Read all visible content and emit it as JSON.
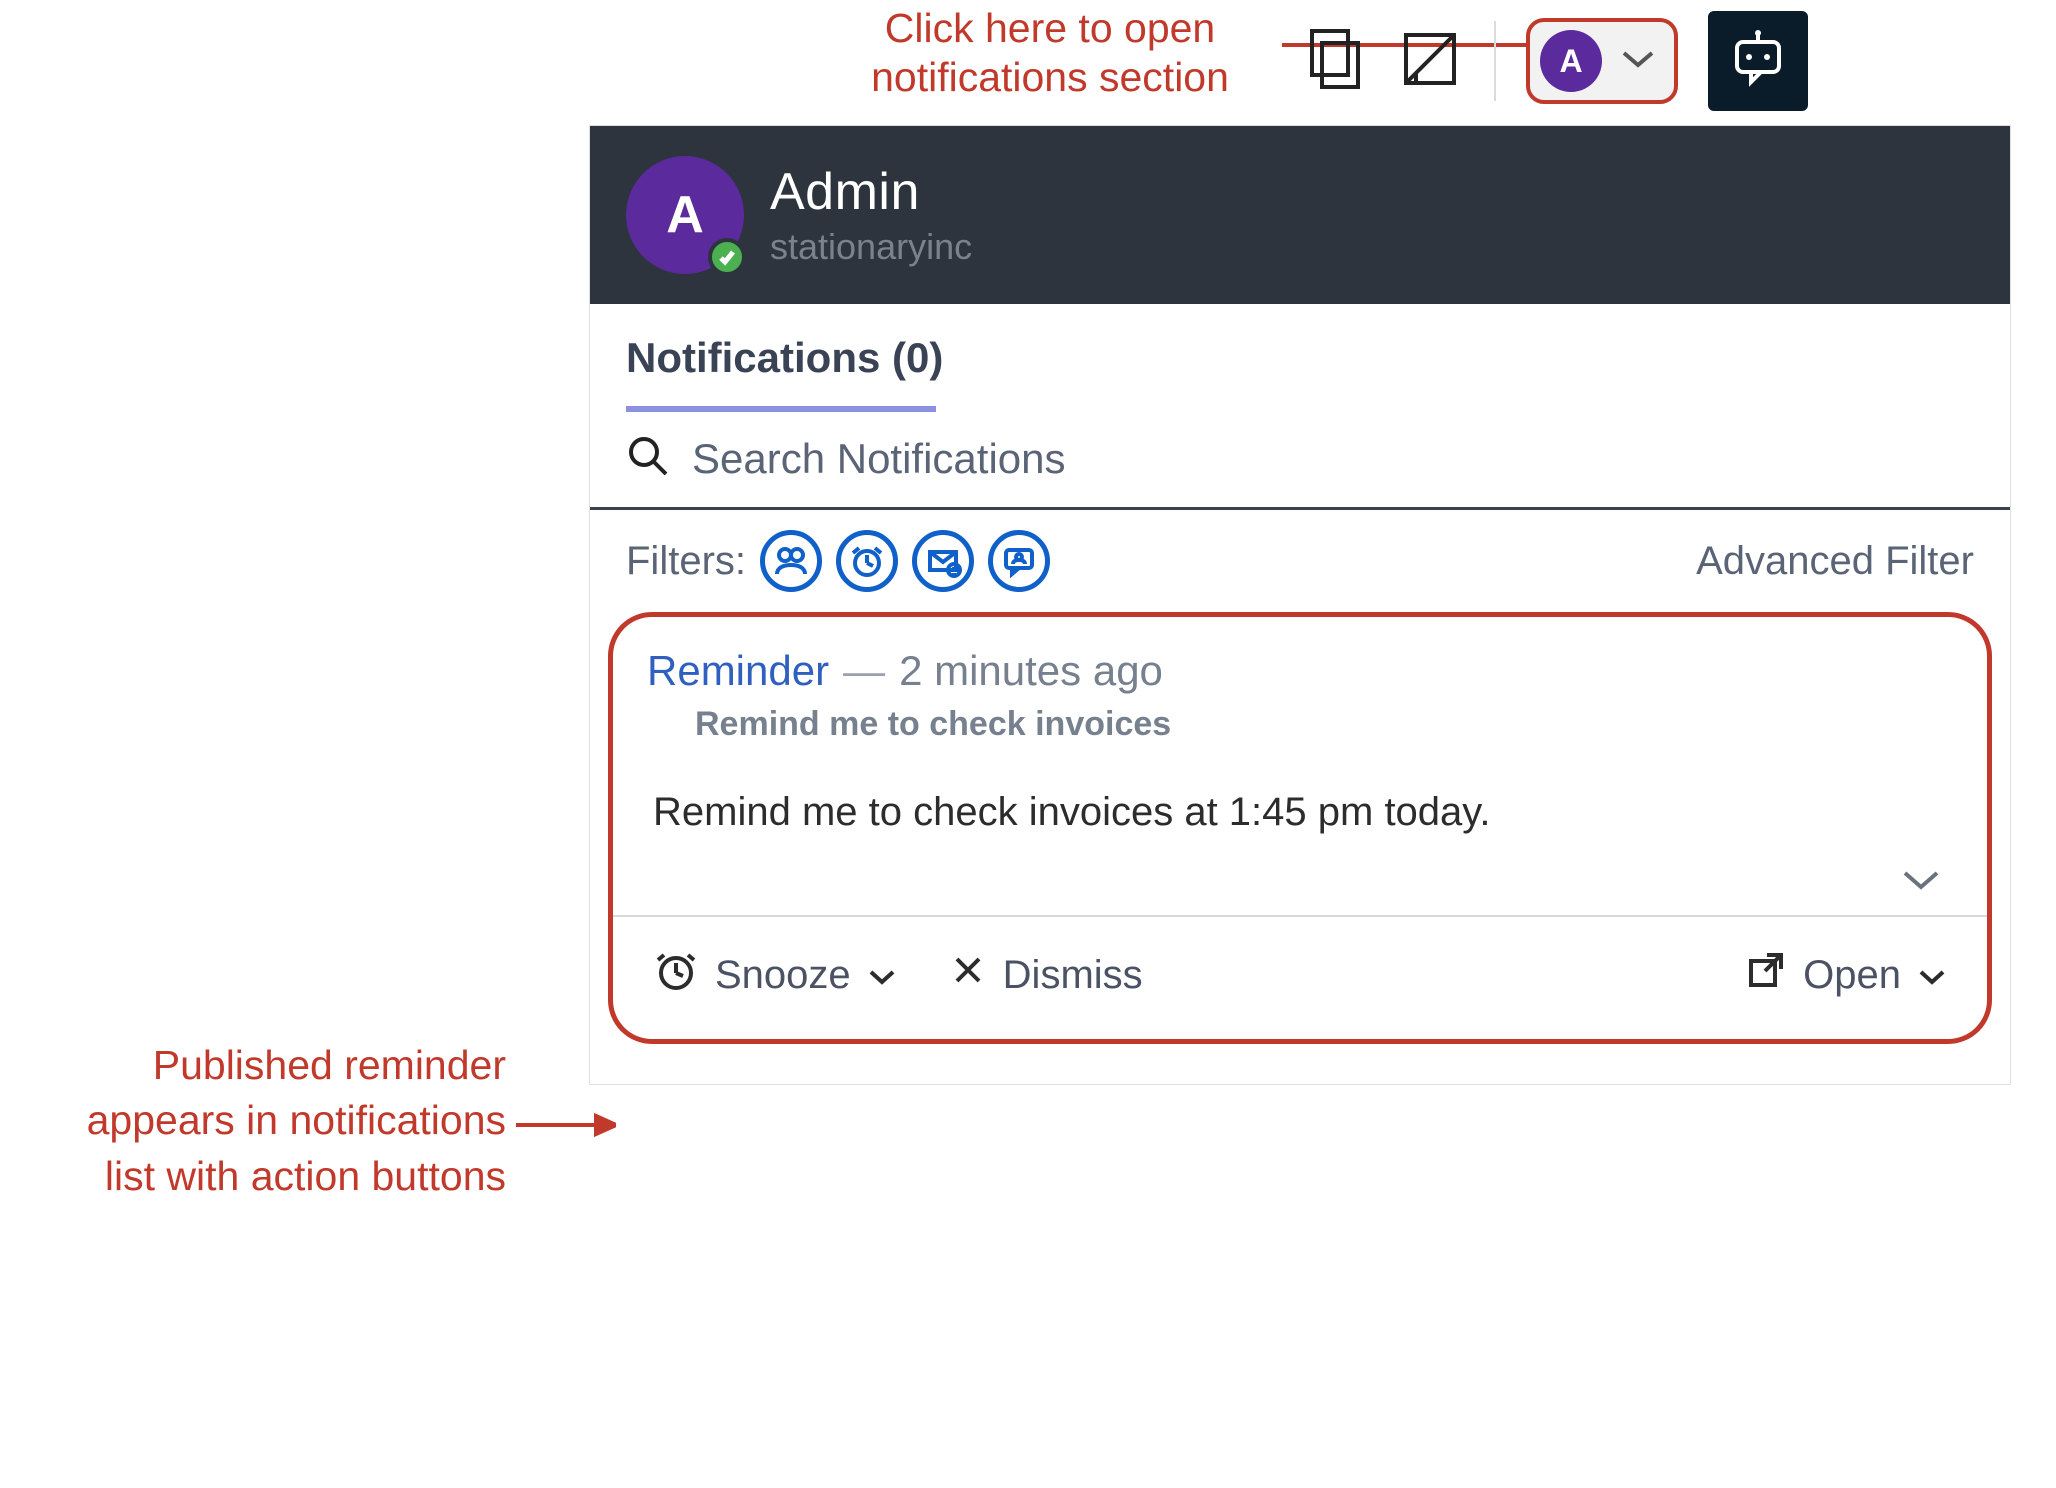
{
  "annotations": {
    "top": "Click here to open\nnotifications section",
    "left": "Published reminder appears in notifications list with action buttons"
  },
  "topbar": {
    "avatar_initial": "A"
  },
  "header": {
    "avatar_initial": "A",
    "name": "Admin",
    "org": "stationaryinc"
  },
  "tabs": {
    "notifications_label": "Notifications  (0)"
  },
  "search": {
    "placeholder": "Search Notifications"
  },
  "filters": {
    "label": "Filters:",
    "advanced_label": "Advanced Filter",
    "icons": [
      "people-icon",
      "clock-icon",
      "mail-alert-icon",
      "chat-person-icon"
    ]
  },
  "notification": {
    "title": "Reminder",
    "separator": "—",
    "time": "2 minutes ago",
    "subtitle": "Remind me to check invoices",
    "body": "Remind me to check invoices at 1:45 pm today."
  },
  "actions": {
    "snooze": "Snooze",
    "dismiss": "Dismiss",
    "open": "Open"
  }
}
